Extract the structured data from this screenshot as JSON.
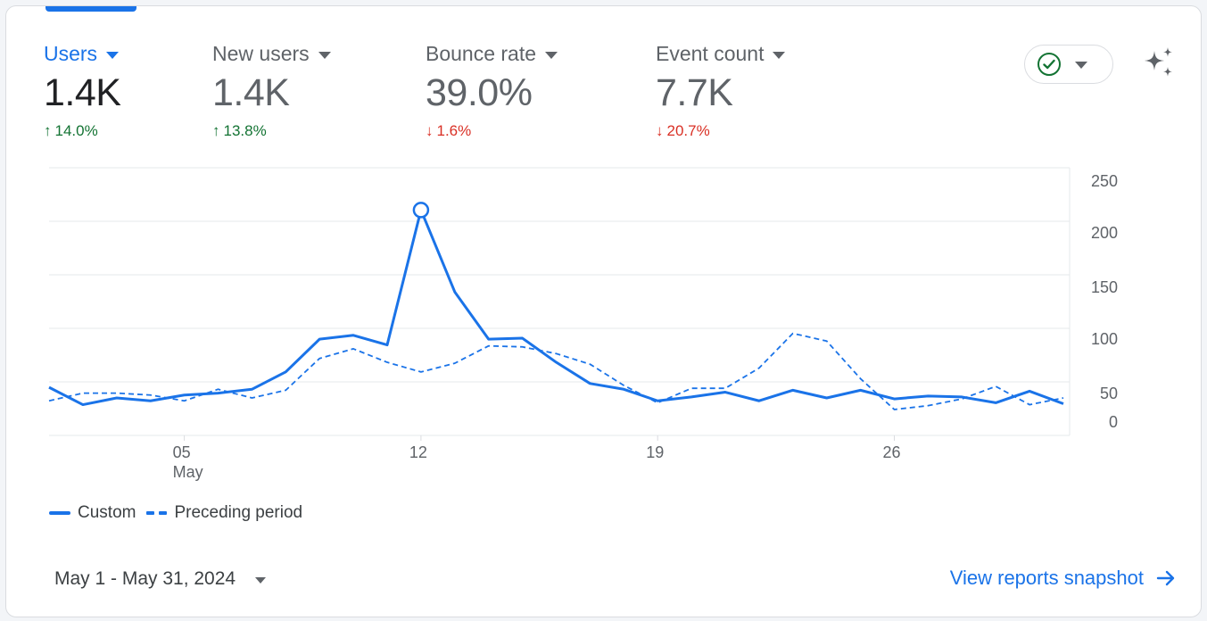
{
  "metrics": [
    {
      "label": "Users",
      "value": "1.4K",
      "change": "14.0%",
      "direction": "up"
    },
    {
      "label": "New users",
      "value": "1.4K",
      "change": "13.8%",
      "direction": "up"
    },
    {
      "label": "Bounce rate",
      "value": "39.0%",
      "change": "1.6%",
      "direction": "down"
    },
    {
      "label": "Event count",
      "value": "7.7K",
      "change": "20.7%",
      "direction": "down"
    }
  ],
  "icons": {
    "status": "check-circle-icon",
    "insights": "sparkle-icon",
    "link_arrow": "arrow-right-icon"
  },
  "colors": {
    "accent": "#1a73e8",
    "up": "#137333",
    "down": "#d93025"
  },
  "chart_data": {
    "type": "line",
    "ylim": [
      0,
      250
    ],
    "y_ticks": [
      "250",
      "200",
      "150",
      "100",
      "50",
      "0"
    ],
    "x_ticks": [
      {
        "day": 5,
        "label": "05",
        "sublabel": "May"
      },
      {
        "day": 12,
        "label": "12",
        "sublabel": ""
      },
      {
        "day": 19,
        "label": "19",
        "sublabel": ""
      },
      {
        "day": 26,
        "label": "26",
        "sublabel": ""
      }
    ],
    "x": [
      1,
      2,
      3,
      4,
      5,
      6,
      7,
      8,
      9,
      10,
      11,
      12,
      13,
      14,
      15,
      16,
      17,
      18,
      19,
      20,
      21,
      22,
      23,
      24,
      25,
      26,
      27,
      28,
      29,
      30,
      31
    ],
    "series": [
      {
        "name": "Custom",
        "style": "solid",
        "values": [
          36,
          18,
          25,
          22,
          28,
          30,
          34,
          52,
          86,
          90,
          80,
          220,
          135,
          86,
          87,
          62,
          40,
          34,
          22,
          26,
          31,
          22,
          33,
          25,
          33,
          24,
          27,
          26,
          20,
          32,
          19
        ]
      },
      {
        "name": "Preceding period",
        "style": "dashed",
        "values": [
          22,
          30,
          30,
          28,
          22,
          34,
          25,
          33,
          66,
          76,
          62,
          52,
          61,
          79,
          78,
          71,
          60,
          38,
          20,
          35,
          35,
          56,
          92,
          84,
          45,
          13,
          17,
          24,
          37,
          18,
          25
        ]
      }
    ],
    "highlight_index": 11,
    "grid": true,
    "legend": "bottom-left"
  },
  "footer": {
    "date_range": "May 1 - May 31, 2024",
    "view_link": "View reports snapshot"
  }
}
